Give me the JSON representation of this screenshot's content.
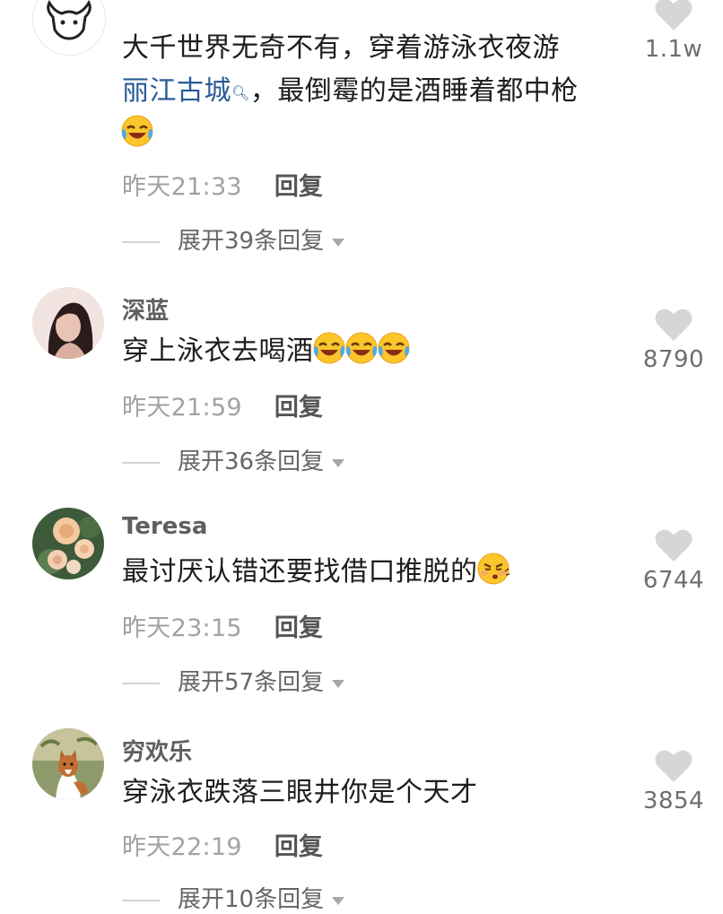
{
  "comments": [
    {
      "username": "",
      "text_line1": "大千世界无奇不有，穿着游泳衣夜游",
      "link_text": "丽江古城",
      "text_line2_rest": "，最倒霉的是酒睡着都中枪",
      "time": "昨天21:33",
      "reply_label": "回复",
      "expand_label": "展开39条回复",
      "likes": "1.1w",
      "avatar_icon": "bull-skull-avatar-icon",
      "emoji_icon": "laughing-crying-emoji-icon"
    },
    {
      "username": "深蓝",
      "text": "穿上泳衣去喝酒",
      "time": "昨天21:59",
      "reply_label": "回复",
      "expand_label": "展开36条回复",
      "likes": "8790",
      "avatar_icon": "woman-portrait-avatar-icon",
      "emoji_icon": "laughing-crying-emoji-icon"
    },
    {
      "username": "Teresa",
      "text": "最讨厌认错还要找借口推脱的",
      "time": "昨天23:15",
      "reply_label": "回复",
      "expand_label": "展开57条回复",
      "likes": "6744",
      "avatar_icon": "roses-avatar-icon",
      "emoji_icon": "sulking-emoji-icon"
    },
    {
      "username": "穷欢乐",
      "text": "穿泳衣跌落三眼井你是个天才",
      "time": "昨天22:19",
      "reply_label": "回复",
      "expand_label": "展开10条回复",
      "likes": "3854",
      "avatar_icon": "dog-avatar-icon"
    }
  ],
  "colors": {
    "link": "#2a5b94",
    "heart": "#d6d6d6",
    "time": "#a2a2a2",
    "username": "#5f5f5f"
  }
}
